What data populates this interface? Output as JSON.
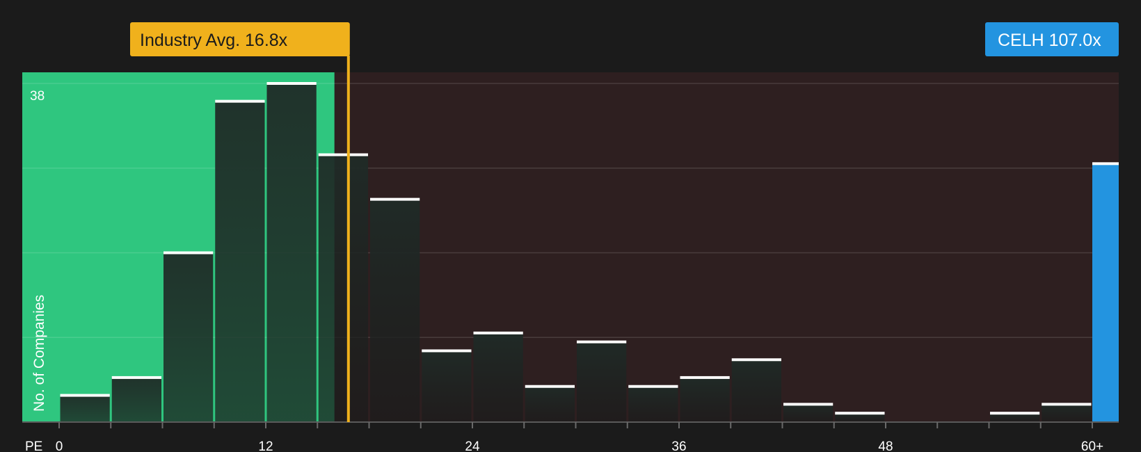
{
  "chart_data": {
    "type": "bar",
    "xlabel": "PE",
    "ylabel": "No. of Companies",
    "x_ticks": [
      "0",
      "12",
      "24",
      "36",
      "48",
      "60+"
    ],
    "y_tick_label": "38",
    "ylim": [
      0,
      38
    ],
    "bins": [
      {
        "x0": 0,
        "x1": 3,
        "value": 3
      },
      {
        "x0": 3,
        "x1": 6,
        "value": 5
      },
      {
        "x0": 6,
        "x1": 9,
        "value": 19
      },
      {
        "x0": 9,
        "x1": 12,
        "value": 36
      },
      {
        "x0": 12,
        "x1": 15,
        "value": 38
      },
      {
        "x0": 15,
        "x1": 18,
        "value": 30
      },
      {
        "x0": 18,
        "x1": 21,
        "value": 25
      },
      {
        "x0": 21,
        "x1": 24,
        "value": 8
      },
      {
        "x0": 24,
        "x1": 27,
        "value": 10
      },
      {
        "x0": 27,
        "x1": 30,
        "value": 4
      },
      {
        "x0": 30,
        "x1": 33,
        "value": 9
      },
      {
        "x0": 33,
        "x1": 36,
        "value": 4
      },
      {
        "x0": 36,
        "x1": 39,
        "value": 5
      },
      {
        "x0": 39,
        "x1": 42,
        "value": 7
      },
      {
        "x0": 42,
        "x1": 45,
        "value": 2
      },
      {
        "x0": 45,
        "x1": 48,
        "value": 1
      },
      {
        "x0": 48,
        "x1": 51,
        "value": 0
      },
      {
        "x0": 51,
        "x1": 54,
        "value": 0
      },
      {
        "x0": 54,
        "x1": 57,
        "value": 1
      },
      {
        "x0": 57,
        "x1": 60,
        "value": 2
      }
    ],
    "highlight": {
      "label": "CELH 107.0x",
      "value": 29,
      "color": "#2394e0"
    },
    "industry_avg": {
      "label": "Industry Avg. 16.8x",
      "value": 16.8,
      "color": "#f0b11c"
    },
    "colors": {
      "below_avg_region": "#2fc67f",
      "above_avg_region": "#2e1f20",
      "background": "#1b1b1b"
    },
    "grid": true
  }
}
